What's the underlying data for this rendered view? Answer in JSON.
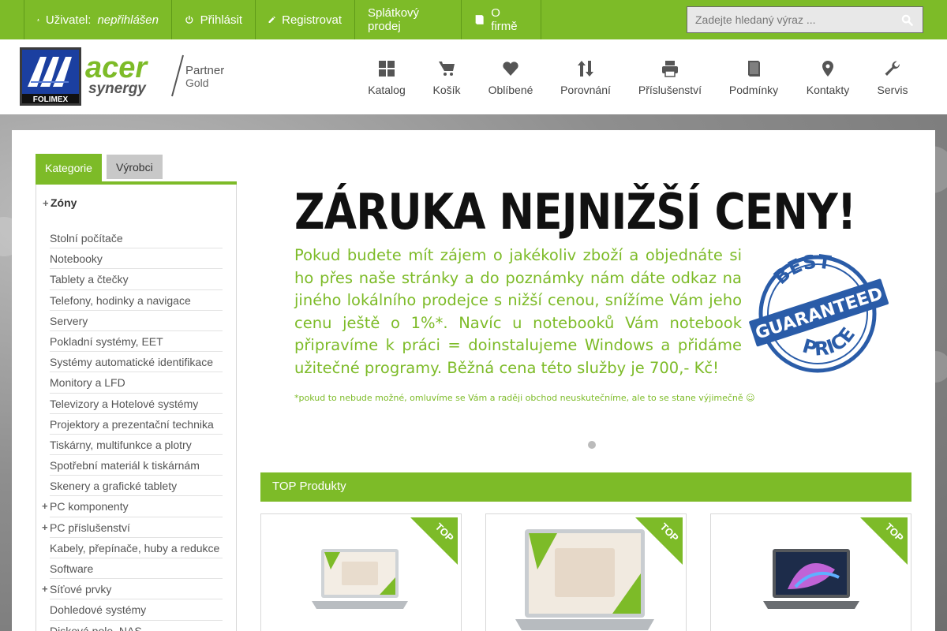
{
  "topbar": {
    "user_label": "Uživatel:",
    "user_status": "nepřihlášen",
    "login": "Přihlásit",
    "register": "Registrovat",
    "installment": "Splátkový prodej",
    "about": "O firmě"
  },
  "search": {
    "placeholder": "Zadejte hledaný výraz ..."
  },
  "logos": {
    "folimex": "FOLIMEX",
    "acer": "acer",
    "synergy": "synergy",
    "partner": "Partner",
    "gold": "Gold"
  },
  "nav": {
    "catalog": "Katalog",
    "cart": "Košík",
    "favorites": "Oblíbené",
    "compare": "Porovnání",
    "accessories": "Příslušenství",
    "terms": "Podmínky",
    "contacts": "Kontakty",
    "service": "Servis"
  },
  "tabs": {
    "categories": "Kategorie",
    "manufacturers": "Výrobci"
  },
  "sidebar": {
    "zones": "Zóny",
    "items": [
      "Stolní počítače",
      "Notebooky",
      "Tablety a čtečky",
      "Telefony, hodinky a navigace",
      "Servery",
      "Pokladní systémy, EET",
      "Systémy automatické identifikace",
      "Monitory a LFD",
      "Televizory a Hotelové systémy",
      "Projektory a prezentační technika",
      "Tiskárny, multifunkce a plotry",
      "Spotřební materiál k tiskárnám",
      "Skenery a grafické tablety",
      "PC komponenty",
      "PC příslušenství",
      "Kabely, přepínače, huby a redukce",
      "Software",
      "Síťové prvky",
      "Dohledové systémy",
      "Disková pole, NAS"
    ]
  },
  "banner": {
    "title": "ZÁRUKA NEJNIŽŠÍ CENY!",
    "text": "Pokud budete mít zájem o jakékoliv zboží a objednáte si ho přes naše stránky a do poznámky nám dáte odkaz na jiného lokálního prodejce s nižší cenou, snížíme Vám jeho cenu ještě o 1%*. Navíc u notebooků Vám notebook připravíme k práci = doinstalujeme Windows a přidáme užitečné programy. Běžná cena této služby je 700,- Kč!",
    "note": "*pokud to nebude možné, omluvíme se Vám a raději obchod neuskutečníme, ale to se stane výjimečně ☺",
    "seal_top": "BEST",
    "seal_mid": "GUARANTEED",
    "seal_bottom": "PRICE"
  },
  "top_products": {
    "title": "TOP Produkty",
    "badge": "TOP"
  },
  "colors": {
    "brand_green": "#7dbb28",
    "seal_blue": "#2a5ca8"
  }
}
